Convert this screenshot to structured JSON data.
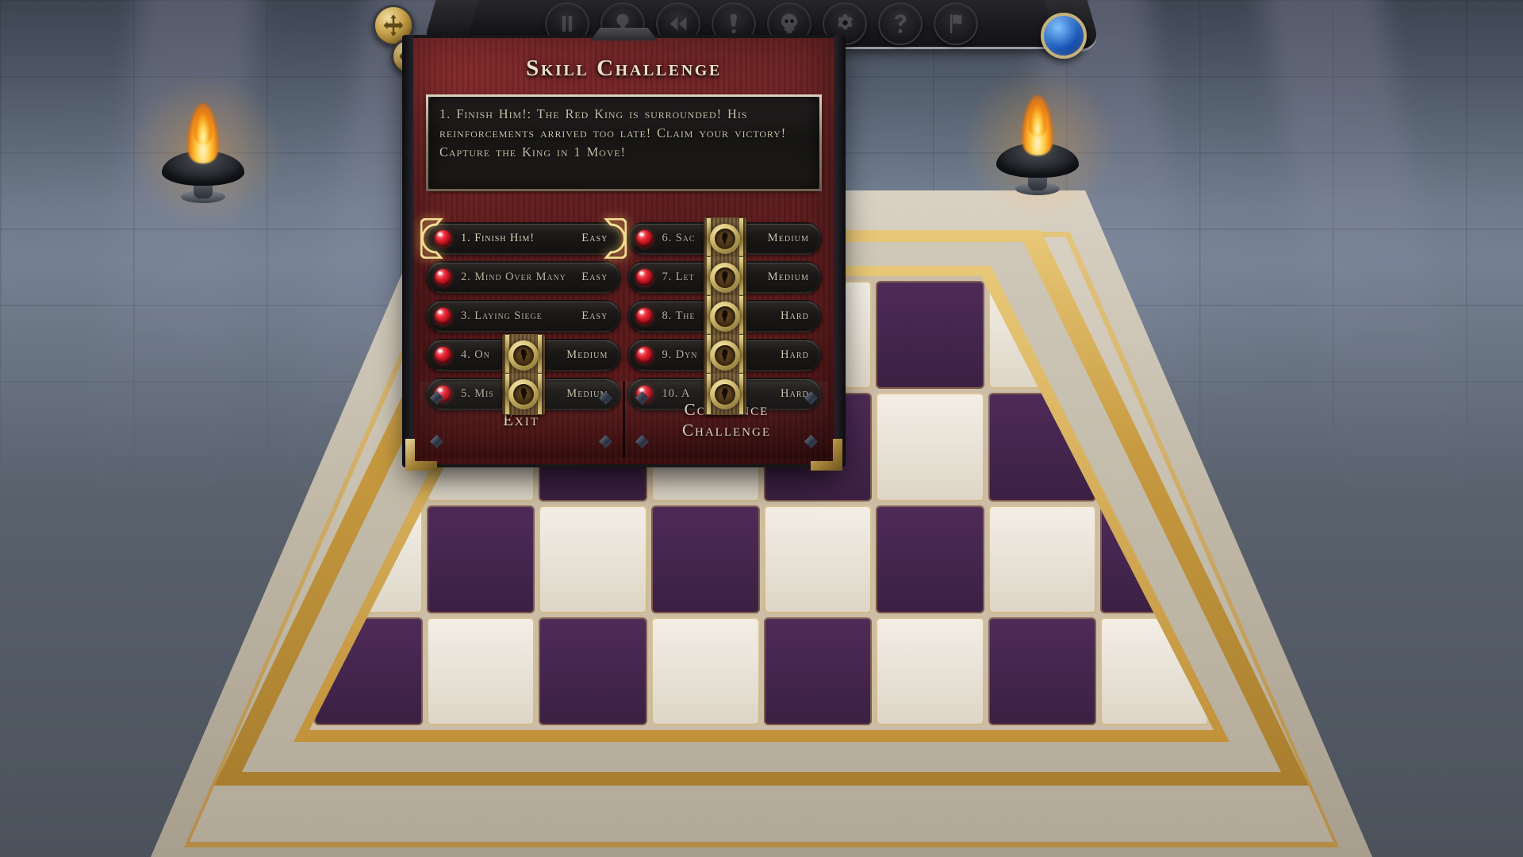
{
  "window": {
    "title": "Skill Challenge"
  },
  "toolbar": {
    "buttons": [
      {
        "name": "pause-icon",
        "label": "Pause"
      },
      {
        "name": "hint-icon",
        "label": "Hint"
      },
      {
        "name": "undo-icon",
        "label": "Undo Move"
      },
      {
        "name": "move-list-icon",
        "label": "Move List"
      },
      {
        "name": "resign-icon",
        "label": "Resign"
      },
      {
        "name": "settings-icon",
        "label": "Settings"
      },
      {
        "name": "help-icon",
        "label": "Help"
      },
      {
        "name": "flag-icon",
        "label": "Surrender"
      }
    ],
    "left_orbs": [
      {
        "name": "move-compass-orb",
        "label": "Move"
      },
      {
        "name": "eye-view-orb",
        "label": "View"
      }
    ],
    "right_orb": {
      "name": "blue-orb",
      "label": "Status"
    }
  },
  "description": {
    "text": "1. Finish Him!: The Red King is surrounded! His reinforcements arrived too late! Claim your victory! Capture the King in 1 Move!"
  },
  "challenges": {
    "left_column": [
      {
        "index": "1.",
        "title": "Finish Him!",
        "difficulty": "Easy",
        "locked": false,
        "selected": true
      },
      {
        "index": "2.",
        "title": "Mind Over Many",
        "difficulty": "Easy",
        "locked": false,
        "selected": false
      },
      {
        "index": "3.",
        "title": "Laying Siege",
        "difficulty": "Easy",
        "locked": false,
        "selected": false
      },
      {
        "index": "4.",
        "title": "On",
        "difficulty": "Medium",
        "locked": true,
        "selected": false
      },
      {
        "index": "5.",
        "title": "Mis",
        "difficulty": "Medium",
        "locked": true,
        "selected": false
      }
    ],
    "right_column": [
      {
        "index": "6.",
        "title": "Sac",
        "difficulty": "Medium",
        "locked": true,
        "selected": false
      },
      {
        "index": "7.",
        "title": "Let",
        "difficulty": "Medium",
        "locked": true,
        "selected": false
      },
      {
        "index": "8.",
        "title": "The",
        "difficulty": "Hard",
        "locked": true,
        "selected": false
      },
      {
        "index": "9.",
        "title": "Dyn",
        "difficulty": "Hard",
        "locked": true,
        "selected": false
      },
      {
        "index": "10.",
        "title": "A",
        "difficulty": "Hard",
        "locked": true,
        "selected": false
      }
    ]
  },
  "footer": {
    "exit_label": "Exit",
    "commence_line1": "Commence",
    "commence_line2": "Challenge"
  },
  "colors": {
    "panel_red": "#6b1a1b",
    "gold": "#c9a24a",
    "parchment_text": "#cdc6b0",
    "gem_red": "#e62230",
    "board_dark": "#4e2b58",
    "board_light": "#f3efe6"
  }
}
